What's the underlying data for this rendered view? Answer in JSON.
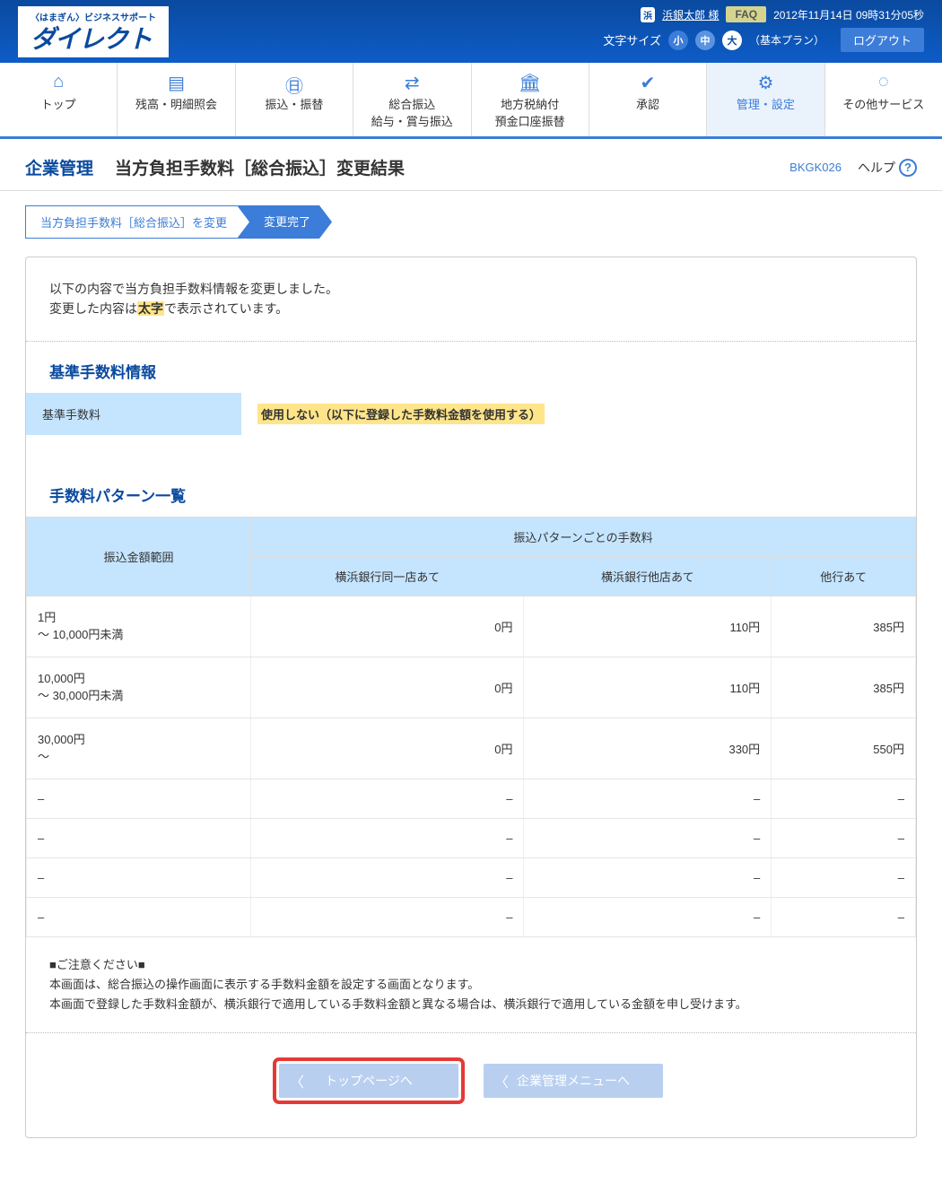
{
  "header": {
    "logo_small": "〈はまぎん〉ビジネスサポート",
    "logo_main": "ダイレクト",
    "user_icon": "浜",
    "user_name": "浜銀太郎 様",
    "faq": "FAQ",
    "datetime": "2012年11月14日 09時31分05秒",
    "font_size_label": "文字サイズ",
    "size_small": "小",
    "size_med": "中",
    "size_large": "大",
    "plan": "（基本プラン）",
    "logout": "ログアウト"
  },
  "nav": {
    "items": [
      {
        "label": "トップ"
      },
      {
        "label": "残高・明細照会"
      },
      {
        "label": "振込・振替"
      },
      {
        "label": "総合振込\n給与・賞与振込"
      },
      {
        "label": "地方税納付\n預金口座振替"
      },
      {
        "label": "承認"
      },
      {
        "label": "管理・設定"
      },
      {
        "label": "その他サービス"
      }
    ]
  },
  "page": {
    "category": "企業管理",
    "title": "当方負担手数料［総合振込］変更結果",
    "code": "BKGK026",
    "help": "ヘルプ"
  },
  "steps": {
    "s1": "当方負担手数料［総合振込］を変更",
    "s2": "変更完了"
  },
  "message": {
    "line1": "以下の内容で当方負担手数料情報を変更しました。",
    "line2a": "変更した内容は",
    "line2b": "太字",
    "line2c": "で表示されています。"
  },
  "section1": {
    "title": "基準手数料情報",
    "label": "基準手数料",
    "value": "使用しない（以下に登録した手数料金額を使用する）"
  },
  "section2": {
    "title": "手数料パターン一覧",
    "col_range": "振込金額範囲",
    "col_group": "振込パターンごとの手数料",
    "col_same": "横浜銀行同一店あて",
    "col_other_branch": "横浜銀行他店あて",
    "col_other_bank": "他行あて",
    "rows": [
      {
        "range": "1円\n～ 10,000円未満",
        "c1": "0円",
        "c2": "110円",
        "c3": "385円"
      },
      {
        "range": "10,000円\n～ 30,000円未満",
        "c1": "0円",
        "c2": "110円",
        "c3": "385円"
      },
      {
        "range": "30,000円\n～",
        "c1": "0円",
        "c2": "330円",
        "c3": "550円"
      },
      {
        "range": "–",
        "c1": "–",
        "c2": "–",
        "c3": "–"
      },
      {
        "range": "–",
        "c1": "–",
        "c2": "–",
        "c3": "–"
      },
      {
        "range": "–",
        "c1": "–",
        "c2": "–",
        "c3": "–"
      },
      {
        "range": "–",
        "c1": "–",
        "c2": "–",
        "c3": "–"
      }
    ]
  },
  "notes": {
    "head": "■ご注意ください■",
    "line1": "本画面は、総合振込の操作画面に表示する手数料金額を設定する画面となります。",
    "line2": "本画面で登録した手数料金額が、横浜銀行で適用している手数料金額と異なる場合は、横浜銀行で適用している金額を申し受けます。"
  },
  "buttons": {
    "top": "トップページへ",
    "menu": "企業管理メニューへ"
  }
}
